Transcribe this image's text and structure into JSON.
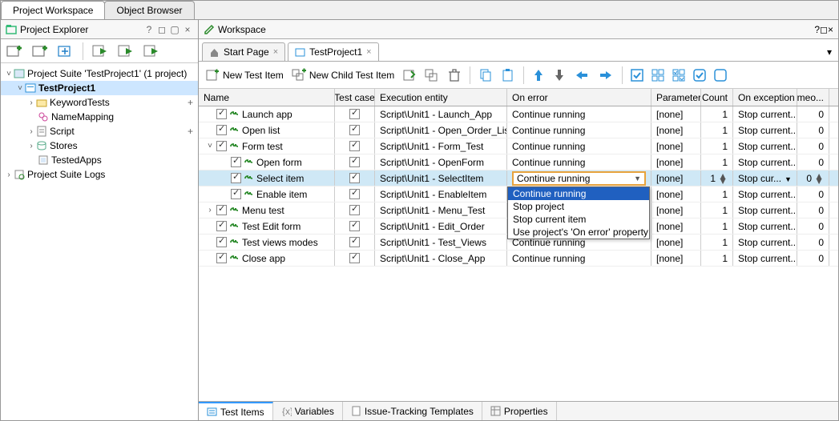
{
  "topTabs": {
    "workspace": "Project Workspace",
    "browser": "Object Browser"
  },
  "explorer": {
    "title": "Project Explorer",
    "nodes": {
      "suite": "Project Suite 'TestProject1' (1 project)",
      "project": "TestProject1",
      "keywordTests": "KeywordTests",
      "nameMapping": "NameMapping",
      "script": "Script",
      "stores": "Stores",
      "testedApps": "TestedApps",
      "logs": "Project Suite Logs"
    }
  },
  "workspace": {
    "title": "Workspace",
    "docs": {
      "start": "Start Page",
      "project": "TestProject1"
    }
  },
  "toolbar": {
    "newItem": "New Test Item",
    "newChild": "New Child Test Item"
  },
  "grid": {
    "headers": {
      "name": "Name",
      "tc": "Test case",
      "exec": "Execution entity",
      "err": "On error",
      "par": "Parameters",
      "cnt": "Count",
      "exc": "On exception",
      "to": "Timeo..."
    },
    "rows": [
      {
        "indent": 0,
        "toggle": "",
        "name": "Launch app",
        "exec": "Script\\Unit1 - Launch_App",
        "err": "Continue running",
        "par": "[none]",
        "cnt": "1",
        "exc": "Stop current...",
        "to": "0"
      },
      {
        "indent": 0,
        "toggle": "",
        "name": "Open list",
        "exec": "Script\\Unit1 - Open_Order_List",
        "err": "Continue running",
        "par": "[none]",
        "cnt": "1",
        "exc": "Stop current...",
        "to": "0"
      },
      {
        "indent": 0,
        "toggle": "v",
        "name": "Form test",
        "exec": "Script\\Unit1 - Form_Test",
        "err": "Continue running",
        "par": "[none]",
        "cnt": "1",
        "exc": "Stop current...",
        "to": "0"
      },
      {
        "indent": 1,
        "toggle": "",
        "name": "Open form",
        "exec": "Script\\Unit1 - OpenForm",
        "err": "Continue running",
        "par": "[none]",
        "cnt": "1",
        "exc": "Stop current...",
        "to": "0"
      },
      {
        "indent": 1,
        "toggle": "",
        "name": "Select item",
        "selected": true,
        "dropdown": true,
        "exec": "Script\\Unit1 - SelectItem",
        "err": "Continue running",
        "par": "[none]",
        "cnt": "1",
        "exc": "Stop cur...",
        "to": "0",
        "spin": true
      },
      {
        "indent": 1,
        "toggle": "",
        "name": "Enable item",
        "exec": "Script\\Unit1 - EnableItem",
        "err": "",
        "par": "[none]",
        "cnt": "1",
        "exc": "Stop current...",
        "to": "0"
      },
      {
        "indent": 0,
        "toggle": ">",
        "name": "Menu test",
        "exec": "Script\\Unit1 - Menu_Test",
        "err": "",
        "par": "[none]",
        "cnt": "1",
        "exc": "Stop current...",
        "to": "0"
      },
      {
        "indent": 0,
        "toggle": "",
        "name": "Test Edit form",
        "exec": "Script\\Unit1 - Edit_Order",
        "err": "",
        "par": "[none]",
        "cnt": "1",
        "exc": "Stop current...",
        "to": "0"
      },
      {
        "indent": 0,
        "toggle": "",
        "name": "Test views modes",
        "exec": "Script\\Unit1 - Test_Views",
        "err": "Continue running",
        "par": "[none]",
        "cnt": "1",
        "exc": "Stop current...",
        "to": "0"
      },
      {
        "indent": 0,
        "toggle": "",
        "name": "Close app",
        "exec": "Script\\Unit1 - Close_App",
        "err": "Continue running",
        "par": "[none]",
        "cnt": "1",
        "exc": "Stop current...",
        "to": "0"
      }
    ],
    "dropdown": {
      "options": [
        "Continue running",
        "Stop project",
        "Stop current item",
        "Use project's 'On error' property"
      ],
      "selectedIndex": 0
    }
  },
  "bottomTabs": {
    "items": "Test Items",
    "vars": "Variables",
    "issue": "Issue-Tracking Templates",
    "props": "Properties"
  }
}
